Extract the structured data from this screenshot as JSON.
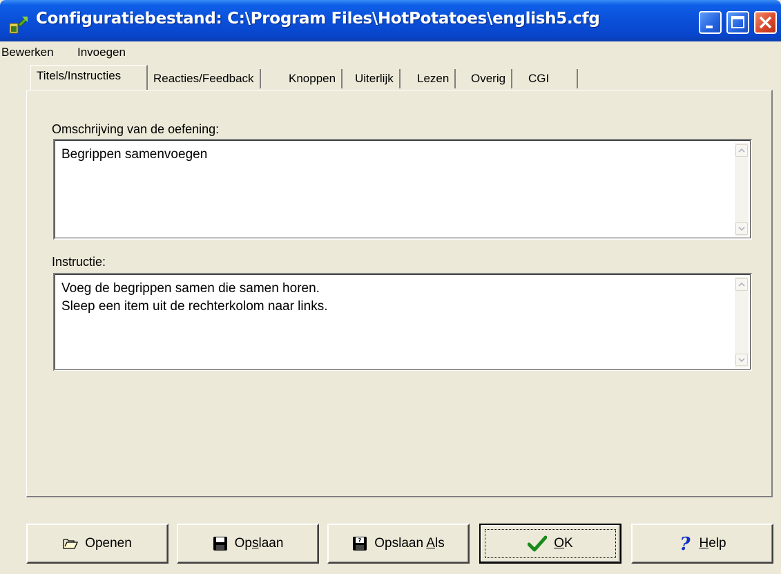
{
  "window": {
    "title": "Configuratiebestand: C:\\Program Files\\HotPotatoes\\english5.cfg"
  },
  "menu": [
    "Bewerken",
    "Invoegen"
  ],
  "tabs": [
    "Titels/Instructies",
    "Reacties/Feedback",
    "Knoppen",
    "Uiterlijk",
    "Lezen",
    "Overig",
    "CGI"
  ],
  "active_tab": "Titels/Instructies",
  "fields": {
    "description": {
      "label": "Omschrijving van de oefening:",
      "value": "Begrippen samenvoegen"
    },
    "instruction": {
      "label": "Instructie:",
      "value": "Voeg de begrippen samen die samen horen.\nSleep een item uit de rechterkolom naar links."
    }
  },
  "buttons": {
    "open": {
      "label": "Openen",
      "icon": "folder-open-icon"
    },
    "save": {
      "pre": "Op",
      "key": "s",
      "post": "laan",
      "icon": "floppy-disk-icon"
    },
    "save_as": {
      "pre": "Opslaan ",
      "key": "A",
      "post": "ls",
      "icon": "save-as-icon"
    },
    "ok": {
      "key": "O",
      "post": "K",
      "icon": "checkmark-icon"
    },
    "help": {
      "key": "H",
      "post": "elp",
      "icon": "question-mark-icon"
    }
  },
  "colors": {
    "titlebar": "#0a4fd8",
    "face": "#ece9d8",
    "check": "#1a8a1a",
    "help": "#1030c8"
  }
}
